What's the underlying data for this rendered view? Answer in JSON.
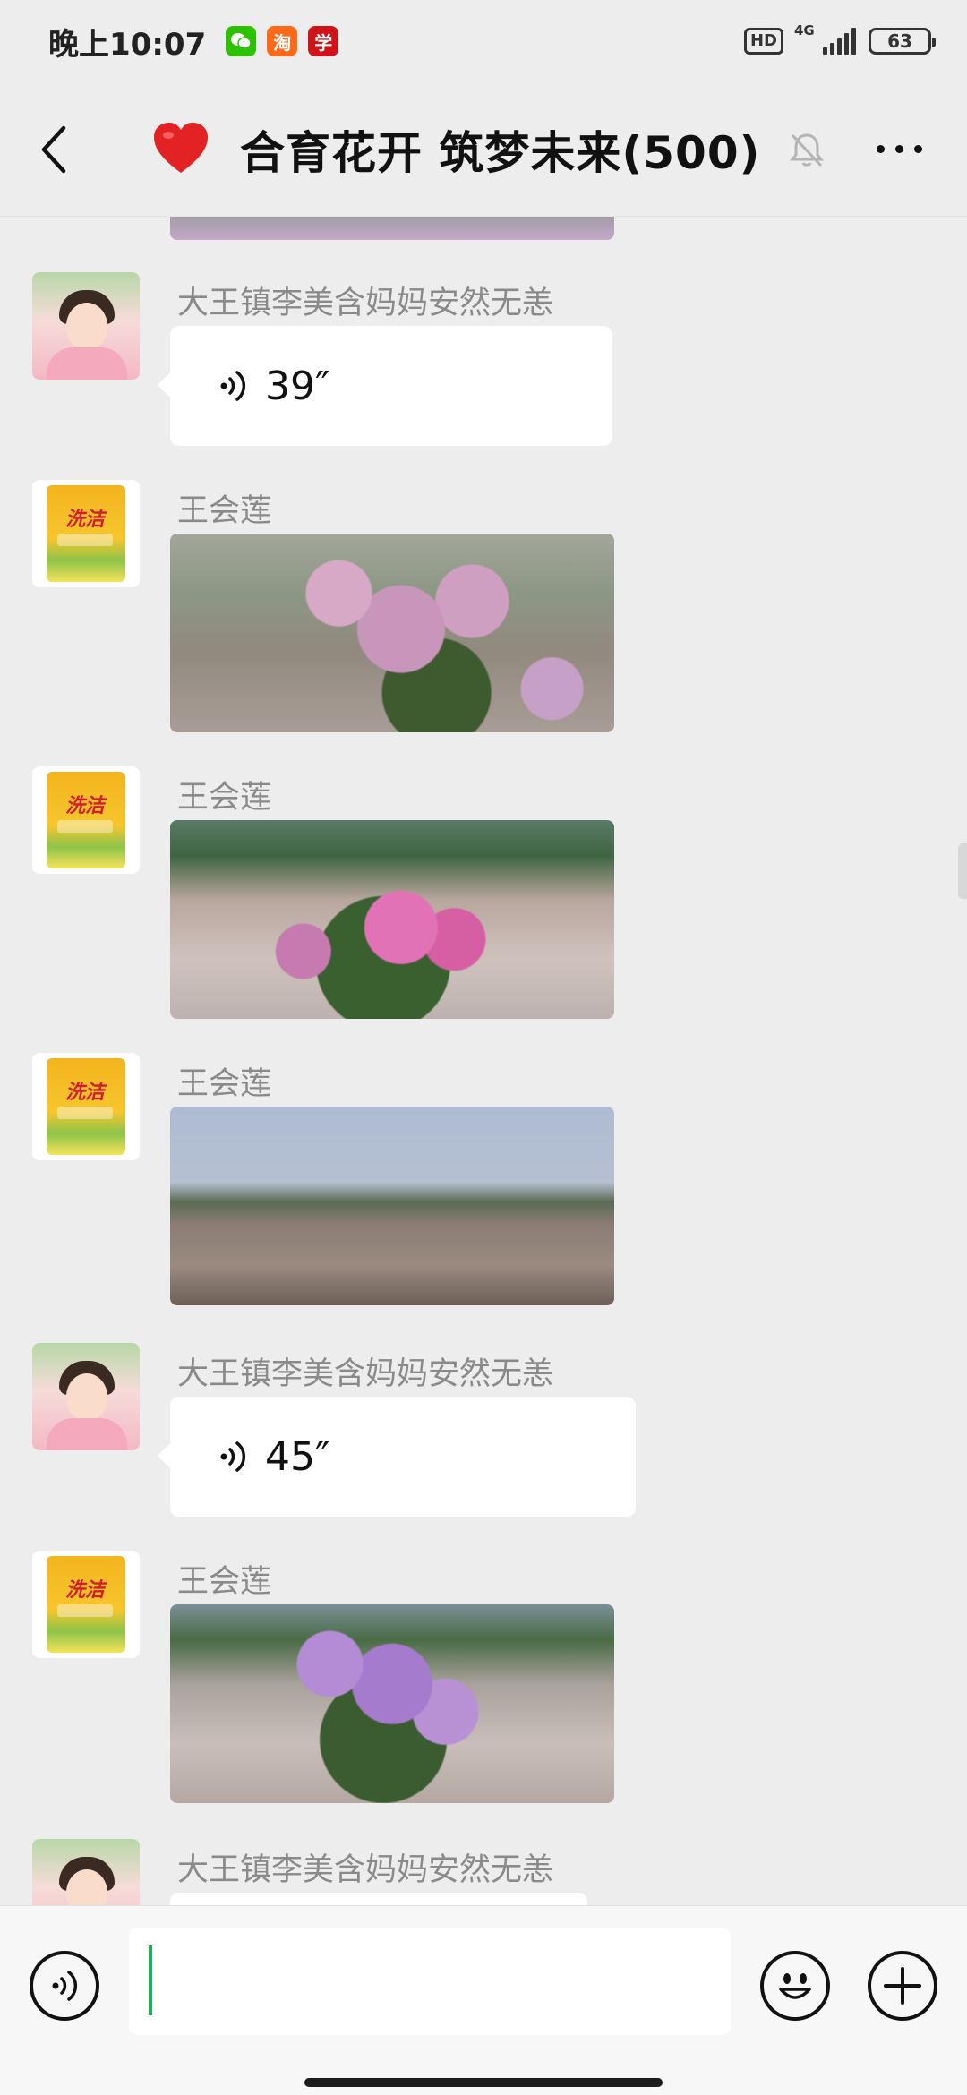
{
  "status_bar": {
    "time": "晚上10:07",
    "notifications": [
      {
        "name": "wechat-icon",
        "glyph": "◉"
      },
      {
        "name": "taobao-icon",
        "glyph": "淘"
      },
      {
        "name": "xuexi-icon",
        "glyph": "学"
      }
    ],
    "hd": "HD",
    "network": "4G",
    "battery": "63"
  },
  "header": {
    "title": "合育花开 筑梦未来(500)",
    "icons": [
      "back-arrow-icon",
      "heart-icon",
      "mute-bell-icon",
      "more-dots-icon"
    ]
  },
  "messages": [
    {
      "type": "image",
      "sender": "",
      "variant": "top-partial"
    },
    {
      "type": "voice",
      "sender": "大王镇李美含妈妈安然无恙",
      "duration": "39″",
      "avatar": "girl-avatar"
    },
    {
      "type": "image",
      "sender": "王会莲",
      "avatar": "product-bag-avatar",
      "variant": "flowers1"
    },
    {
      "type": "image",
      "sender": "王会莲",
      "avatar": "product-bag-avatar",
      "variant": "flowers2"
    },
    {
      "type": "image",
      "sender": "王会莲",
      "avatar": "product-bag-avatar",
      "variant": "road"
    },
    {
      "type": "voice",
      "sender": "大王镇李美含妈妈安然无恙",
      "duration": "45″",
      "avatar": "girl-avatar"
    },
    {
      "type": "image",
      "sender": "王会莲",
      "avatar": "product-bag-avatar",
      "variant": "flowers3"
    },
    {
      "type": "voice",
      "sender": "大王镇李美含妈妈安然无恙",
      "duration": "",
      "avatar": "girl-avatar"
    }
  ],
  "avatar_bag_text": "洗洁",
  "input_bar": {
    "value": "",
    "icons": [
      "voice-input-icon",
      "emoji-icon",
      "plus-icon"
    ]
  },
  "colors": {
    "background": "#ededed",
    "bubble": "#ffffff",
    "caret": "#1aad5a",
    "sender_name": "#8a8a8a"
  }
}
